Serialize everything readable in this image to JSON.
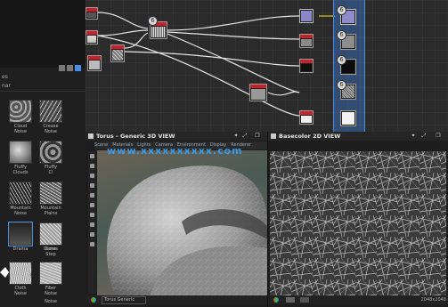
{
  "graph": {
    "badges": [
      "6",
      "6",
      "6",
      "6",
      "6"
    ]
  },
  "library": {
    "tabs": [
      "es",
      "nar"
    ],
    "items": [
      {
        "label": "Cloud\nNoise",
        "row": 0,
        "col": 0
      },
      {
        "label": "Crease\nNoise",
        "row": 0,
        "col": 1
      },
      {
        "label": "Fluffy\nClouds",
        "row": 1,
        "col": 0
      },
      {
        "label": "Fluffy\nCl",
        "row": 1,
        "col": 1
      },
      {
        "label": "Mountain\nNoise",
        "row": 2,
        "col": 0
      },
      {
        "label": "Mountain\nPlains",
        "row": 2,
        "col": 1
      },
      {
        "label": "Drama",
        "row": 3,
        "col": 0
      },
      {
        "label": "Dunes",
        "row": 3,
        "col": 1
      },
      {
        "label": "Cone\nStep",
        "row": 4,
        "col": 1
      },
      {
        "label": "Cloth\nNoise",
        "row": 5,
        "col": 0
      },
      {
        "label": "Fiber\nNoise",
        "row": 5,
        "col": 1
      }
    ],
    "footer": "Noise"
  },
  "view3d": {
    "title": "Torus - Generic  3D VIEW",
    "toolbar": [
      "Scene",
      "Materials",
      "Lights",
      "Camera",
      "Environment",
      "Display",
      "Renderer"
    ],
    "footer_select": "Torus Generic"
  },
  "view2d": {
    "title": "Basecolor  2D VIEW",
    "footer_value": "2048x2048"
  },
  "watermark": "www.xxxxxxxxxx.com",
  "colors": {
    "accent_blue": "#4a8de0",
    "node_header_red": "#c8202a",
    "graph_bg": "#2b2b2b"
  }
}
